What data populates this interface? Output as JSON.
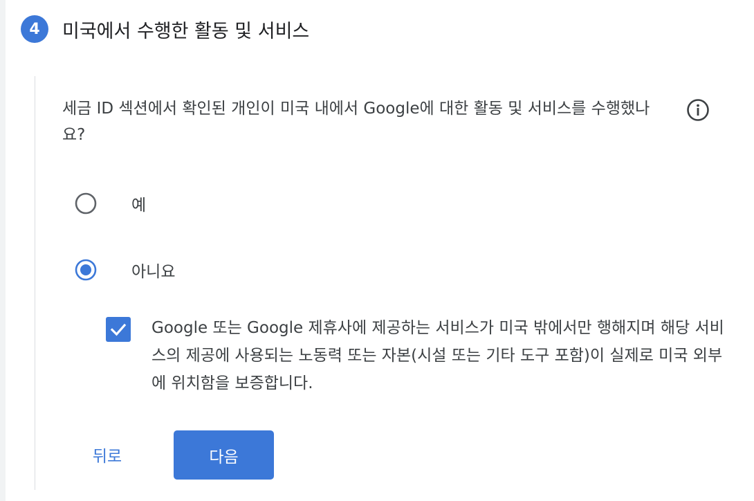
{
  "step": {
    "number": "4",
    "title": "미국에서 수행한 활동 및 서비스"
  },
  "question": {
    "text": "세금 ID 섹션에서 확인된 개인이 미국 내에서 Google에 대한 활동 및 서비스를 수행했나요?",
    "info_icon": "info-icon"
  },
  "options": [
    {
      "label": "예",
      "selected": false
    },
    {
      "label": "아니요",
      "selected": true
    }
  ],
  "certification": {
    "checked": true,
    "text": "Google 또는 Google 제휴사에 제공하는 서비스가 미국 밖에서만 행해지며 해당 서비스의 제공에 사용되는 노동력 또는 자본(시설 또는 기타 도구 포함)이 실제로 미국 외부에 위치함을 보증합니다."
  },
  "buttons": {
    "back_label": "뒤로",
    "next_label": "다음"
  },
  "colors": {
    "accent": "#3c78d8",
    "text": "#3c4043",
    "divider": "#dadce0"
  }
}
